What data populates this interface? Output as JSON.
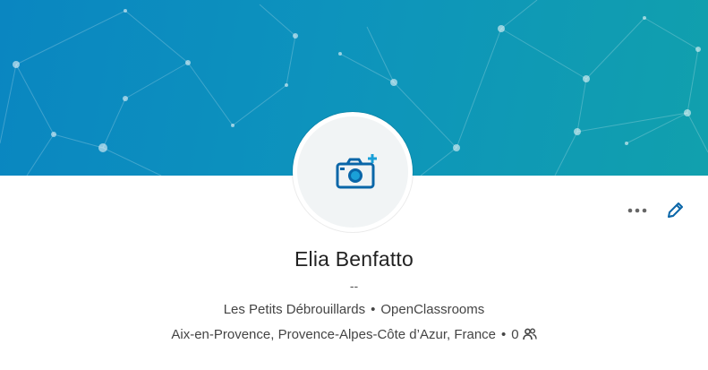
{
  "profile": {
    "name": "Elia Benfatto",
    "headline": "--",
    "companies": [
      "Les Petits Débrouillards",
      "OpenClassrooms"
    ],
    "separator": "•",
    "location": "Aix-en-Provence, Provence-Alpes-Côte d’Azur, France",
    "connections": "0"
  },
  "icons": {
    "avatar": "camera-plus-icon",
    "more": "more-dots-icon",
    "edit": "pencil-icon",
    "connections": "people-icon"
  },
  "colors": {
    "banner_start": "#0a86c1",
    "banner_end": "#11a0ad",
    "accent": "#0a66a8",
    "plus_accent": "#1aa0d8"
  }
}
